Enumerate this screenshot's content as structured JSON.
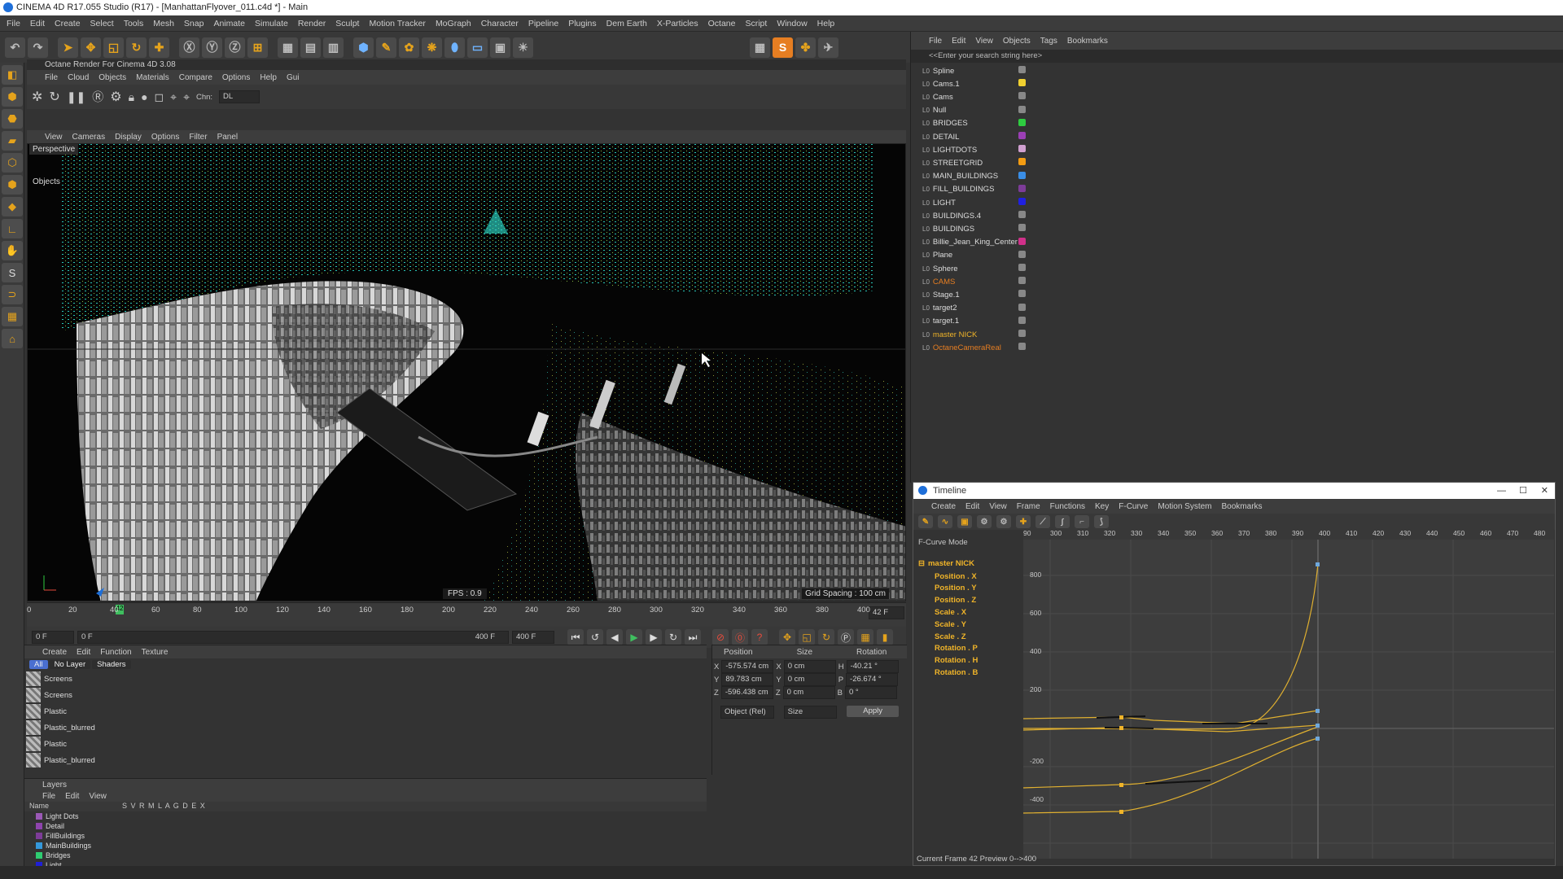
{
  "window": {
    "title": "CINEMA 4D R17.055 Studio (R17) - [ManhattanFlyover_011.c4d *] - Main"
  },
  "menu": [
    "File",
    "Edit",
    "Create",
    "Select",
    "Tools",
    "Mesh",
    "Snap",
    "Animate",
    "Simulate",
    "Render",
    "Sculpt",
    "Motion Tracker",
    "MoGraph",
    "Character",
    "Pipeline",
    "Plugins",
    "Dem Earth",
    "X-Particles",
    "Octane",
    "Script",
    "Window",
    "Help"
  ],
  "octane": {
    "title": "Octane Render For Cinema 4D 3.08",
    "menu": [
      "File",
      "Cloud",
      "Objects",
      "Materials",
      "Compare",
      "Options",
      "Help",
      "Gui"
    ],
    "chn_label": "Chn:",
    "chn_value": "DL"
  },
  "viewport": {
    "menu": [
      "View",
      "Cameras",
      "Display",
      "Options",
      "Filter",
      "Panel"
    ],
    "label": "Perspective",
    "fps": "FPS : 0.9",
    "grid_spacing": "Grid Spacing : 100 cm",
    "objects_tab": "Objects"
  },
  "timeline_ruler": {
    "ticks": [
      "0",
      "20",
      "40",
      "60",
      "80",
      "100",
      "120",
      "140",
      "160",
      "180",
      "200",
      "220",
      "240",
      "260",
      "280",
      "300",
      "320",
      "340",
      "360",
      "380",
      "400"
    ],
    "current": "42",
    "frame_field": "42 F"
  },
  "transport": {
    "start": "0 F",
    "range_start": "0 F",
    "range_end": "400 F",
    "end": "400 F"
  },
  "material_manager": {
    "menu": [
      "Create",
      "Edit",
      "Function",
      "Texture"
    ],
    "filters": [
      "All",
      "No Layer",
      "Shaders"
    ],
    "materials": [
      "Screens",
      "Screens",
      "Plastic",
      "Plastic_blurred",
      "Plastic",
      "Plastic_blurred"
    ]
  },
  "coords": {
    "headers": [
      "Position",
      "Size",
      "Rotation"
    ],
    "rows": [
      {
        "axis": "X",
        "pos": "-575.574 cm",
        "saxis": "X",
        "size": "0 cm",
        "raxis": "H",
        "rot": "-40.21 °"
      },
      {
        "axis": "Y",
        "pos": "89.783 cm",
        "saxis": "Y",
        "size": "0 cm",
        "raxis": "P",
        "rot": "-26.674 °"
      },
      {
        "axis": "Z",
        "pos": "-596.438 cm",
        "saxis": "Z",
        "size": "0 cm",
        "raxis": "B",
        "rot": "0 °"
      }
    ],
    "mode": "Object (Rel)",
    "size_mode": "Size",
    "apply": "Apply"
  },
  "layers": {
    "title": "Layers",
    "menu": [
      "File",
      "Edit",
      "View"
    ],
    "col_name": "Name",
    "cols": "S V R M L A G D E X",
    "items": [
      {
        "name": "Light Dots",
        "color": "#9b59b6"
      },
      {
        "name": "Detail",
        "color": "#8e44ad"
      },
      {
        "name": "FillBuildings",
        "color": "#7d3c98"
      },
      {
        "name": "MainBuildings",
        "color": "#3498db"
      },
      {
        "name": "Bridges",
        "color": "#2ecc71"
      },
      {
        "name": "Light",
        "color": "#1f1fd6"
      }
    ]
  },
  "object_manager": {
    "menu": [
      "File",
      "Edit",
      "View",
      "Objects",
      "Tags",
      "Bookmarks"
    ],
    "search_placeholder": "<<Enter your search string here>",
    "objects": [
      {
        "name": "Spline",
        "color": "#888"
      },
      {
        "name": "Cams.1",
        "color": "#f0d030"
      },
      {
        "name": "Cams",
        "color": "#888"
      },
      {
        "name": "Null",
        "color": "#888"
      },
      {
        "name": "BRIDGES",
        "color": "#2ecc40"
      },
      {
        "name": "DETAIL",
        "color": "#9b3fb5"
      },
      {
        "name": "LIGHTDOTS",
        "color": "#d0a0d0"
      },
      {
        "name": "STREETGRID",
        "color": "#f39c12"
      },
      {
        "name": "MAIN_BUILDINGS",
        "color": "#3a8ee6"
      },
      {
        "name": "FILL_BUILDINGS",
        "color": "#7d3c98"
      },
      {
        "name": "LIGHT",
        "color": "#2020e0"
      },
      {
        "name": "BUILDINGS.4",
        "color": "#888"
      },
      {
        "name": "BUILDINGS",
        "color": "#888"
      },
      {
        "name": "Billie_Jean_King_Center",
        "color": "#d0308a"
      },
      {
        "name": "Plane",
        "color": "#888"
      },
      {
        "name": "Sphere",
        "color": "#888"
      },
      {
        "name": "CAMS",
        "color": "#888"
      },
      {
        "name": "Stage.1",
        "color": "#888"
      },
      {
        "name": "target2",
        "color": "#888"
      },
      {
        "name": "target.1",
        "color": "#888"
      },
      {
        "name": "master NICK",
        "color": "#888"
      },
      {
        "name": "OctaneCameraReal",
        "color": "#888"
      }
    ]
  },
  "timeline_window": {
    "title": "Timeline",
    "menu": [
      "Create",
      "Edit",
      "View",
      "Frame",
      "Functions",
      "Key",
      "F-Curve",
      "Motion System",
      "Bookmarks"
    ],
    "mode_label": "F-Curve Mode",
    "object": "master NICK",
    "tracks": [
      "Position . X",
      "Position . Y",
      "Position . Z",
      "Scale . X",
      "Scale . Y",
      "Scale . Z",
      "Rotation . P",
      "Rotation . H",
      "Rotation . B"
    ],
    "frame_ticks": [
      "90",
      "300",
      "310",
      "320",
      "330",
      "340",
      "350",
      "360",
      "370",
      "380",
      "390",
      "400",
      "410",
      "420",
      "430",
      "440",
      "450",
      "460",
      "470",
      "480"
    ],
    "value_ticks": [
      "800",
      "600",
      "400",
      "200",
      "-200",
      "-400"
    ],
    "status": "Current Frame  42  Preview  0-->400"
  }
}
